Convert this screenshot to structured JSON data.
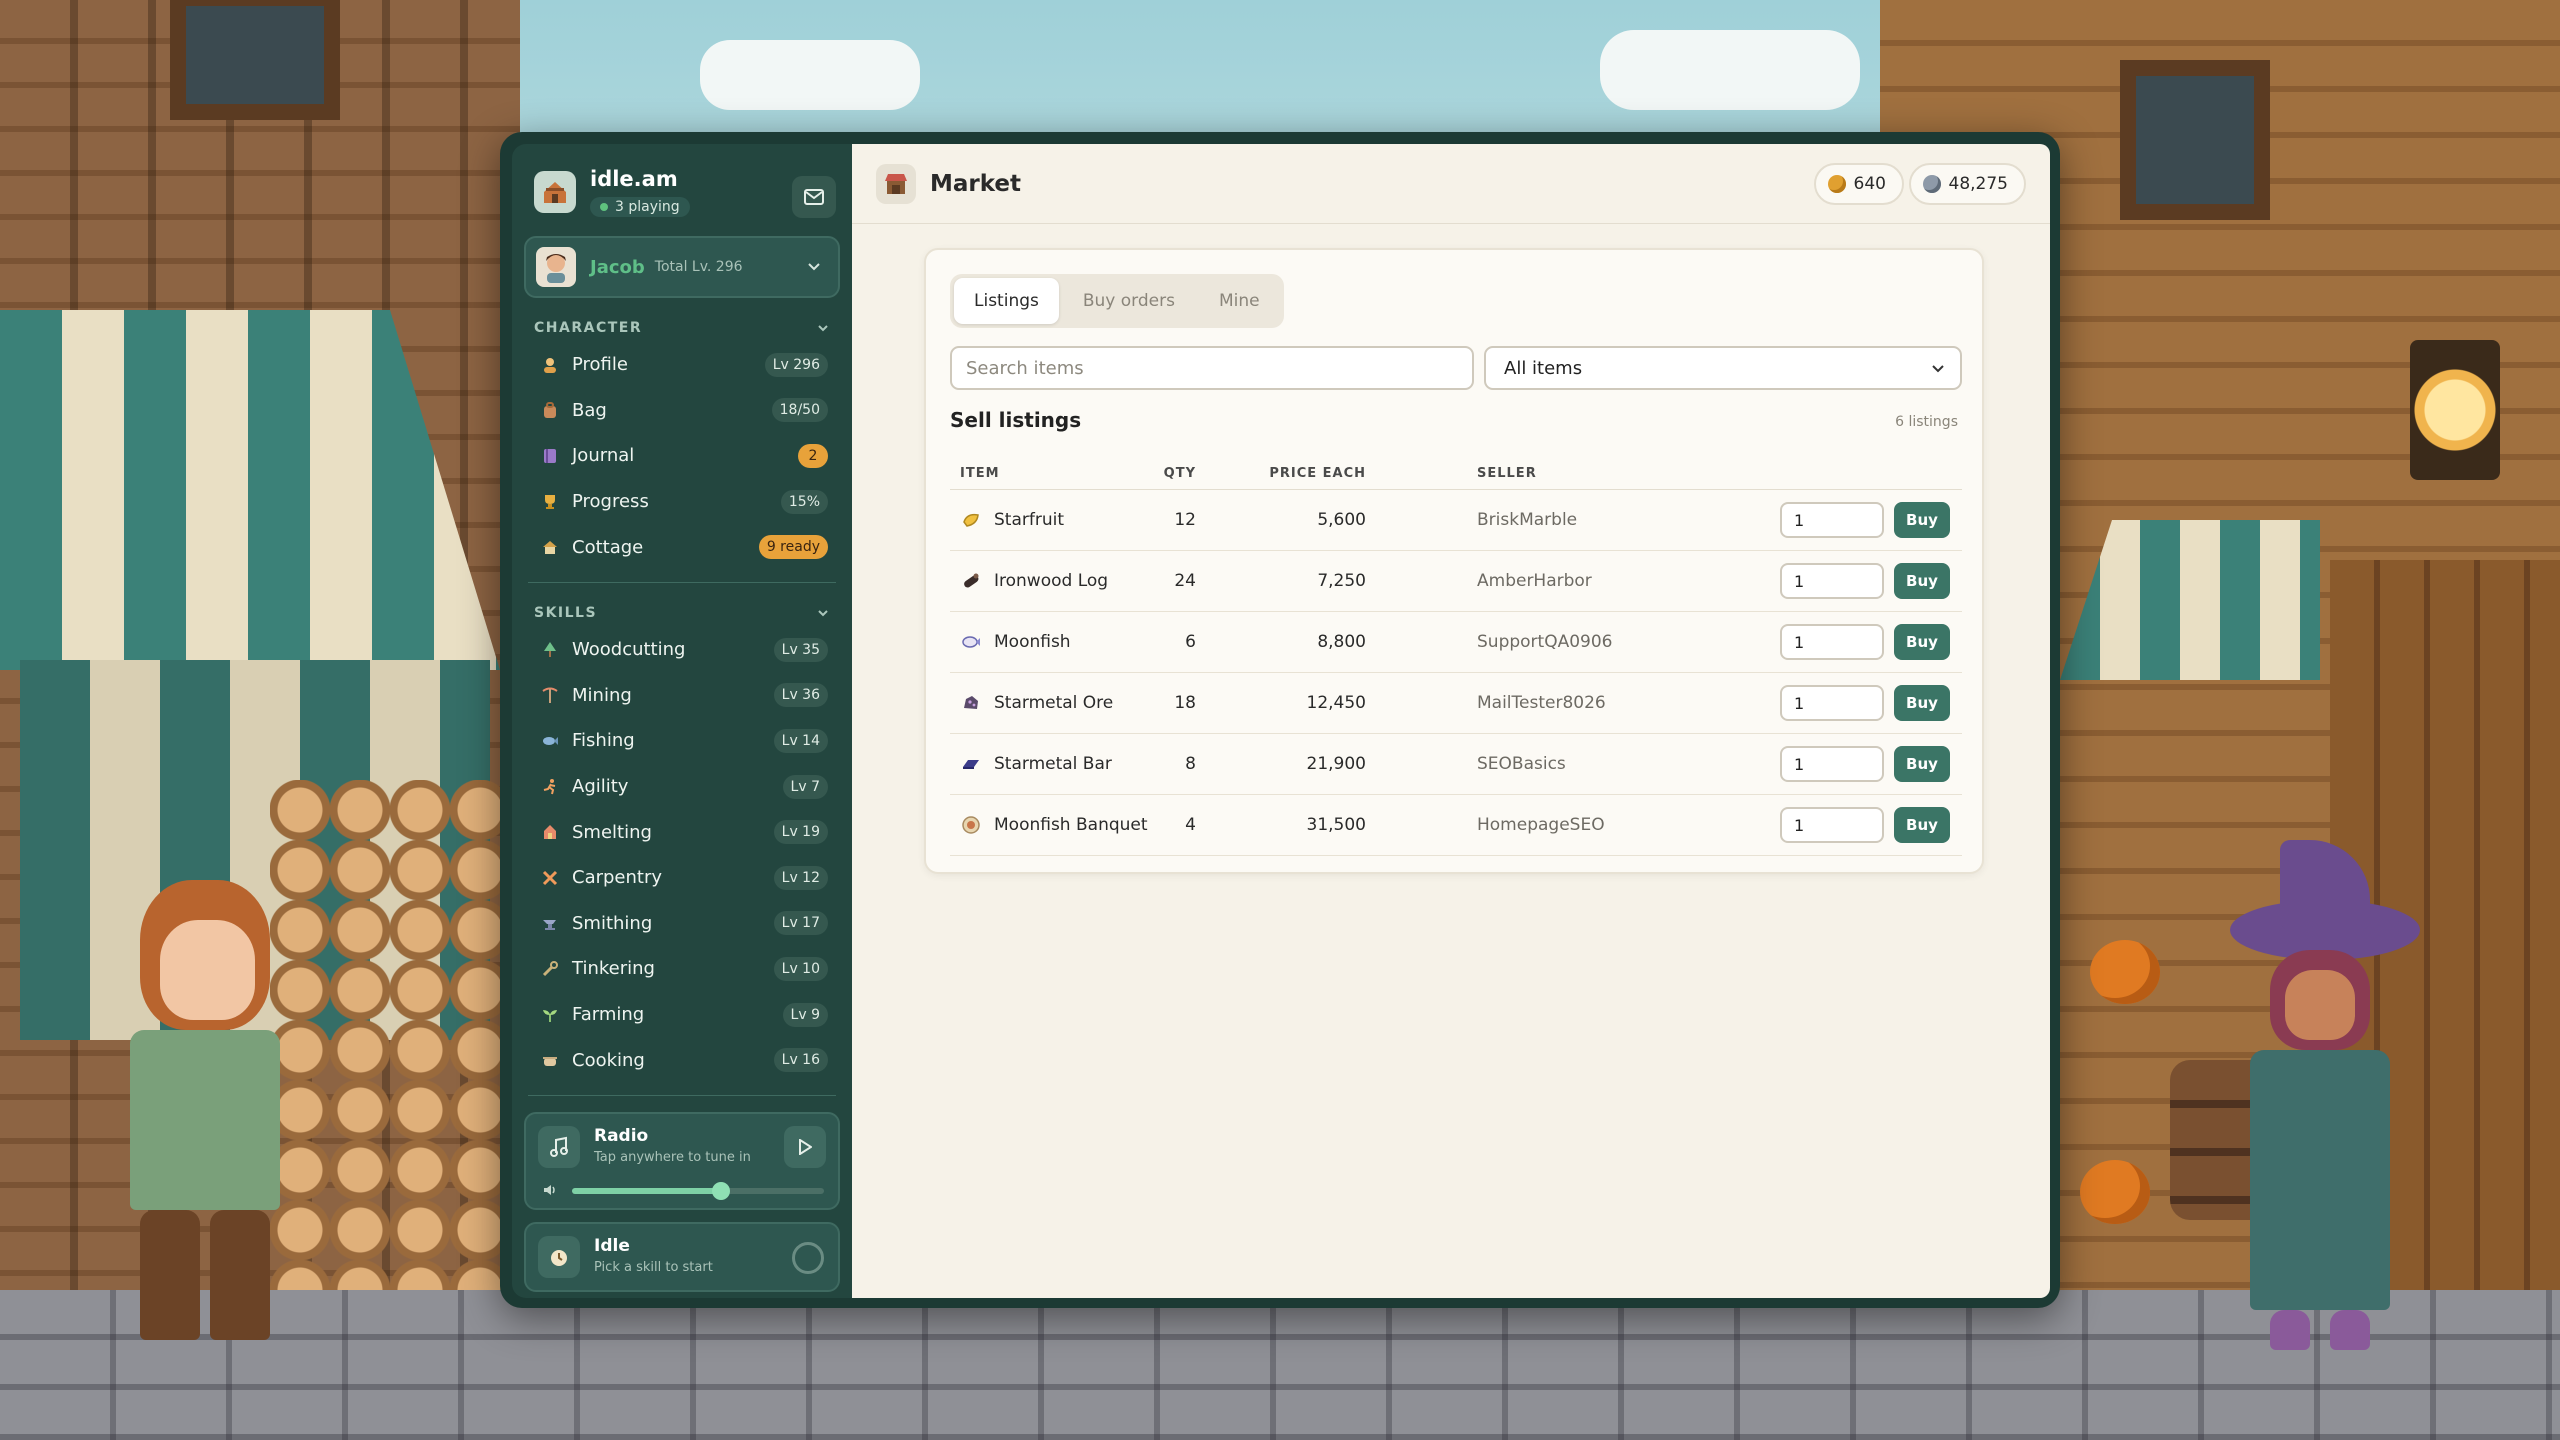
{
  "app": {
    "brand": "idle.am",
    "playing": "3 playing"
  },
  "character": {
    "name": "Jacob",
    "total_level": "Total Lv. 296"
  },
  "sections": {
    "character": "CHARACTER",
    "skills": "SKILLS"
  },
  "character_nav": [
    {
      "label": "Profile",
      "badge": "Lv 296",
      "icon": "person-icon"
    },
    {
      "label": "Bag",
      "badge": "18/50",
      "icon": "bag-icon"
    },
    {
      "label": "Journal",
      "badge": "2",
      "icon": "journal-icon"
    },
    {
      "label": "Progress",
      "badge": "15%",
      "icon": "trophy-icon"
    },
    {
      "label": "Cottage",
      "badge": "9 ready",
      "icon": "cottage-icon"
    }
  ],
  "skills_nav": [
    {
      "label": "Woodcutting",
      "badge": "Lv 35",
      "icon": "tree-icon"
    },
    {
      "label": "Mining",
      "badge": "Lv 36",
      "icon": "pickaxe-icon"
    },
    {
      "label": "Fishing",
      "badge": "Lv 14",
      "icon": "fish-icon"
    },
    {
      "label": "Agility",
      "badge": "Lv 7",
      "icon": "runner-icon"
    },
    {
      "label": "Smelting",
      "badge": "Lv 19",
      "icon": "furnace-icon"
    },
    {
      "label": "Carpentry",
      "badge": "Lv 12",
      "icon": "saw-icon"
    },
    {
      "label": "Smithing",
      "badge": "Lv 17",
      "icon": "anvil-icon"
    },
    {
      "label": "Tinkering",
      "badge": "Lv 10",
      "icon": "wrench-icon"
    },
    {
      "label": "Farming",
      "badge": "Lv 9",
      "icon": "sprout-icon"
    },
    {
      "label": "Cooking",
      "badge": "Lv 16",
      "icon": "pot-icon"
    }
  ],
  "radio": {
    "title": "Radio",
    "subtitle": "Tap anywhere to tune in",
    "volume": 0.59
  },
  "idle": {
    "title": "Idle",
    "subtitle": "Pick a skill to start"
  },
  "header": {
    "title": "Market",
    "gold": "640",
    "silver": "48,275"
  },
  "market": {
    "tabs": [
      "Listings",
      "Buy orders",
      "Mine"
    ],
    "active_tab": "Listings",
    "search_placeholder": "Search items",
    "filter": "All items",
    "list_title": "Sell listings",
    "list_count": "6 listings",
    "columns": {
      "item": "ITEM",
      "qty": "QTY",
      "price": "PRICE EACH",
      "seller": "SELLER"
    },
    "buy_label": "Buy",
    "listings": [
      {
        "item": "Starfruit",
        "qty": "12",
        "price": "5,600",
        "seller": "BriskMarble",
        "amount": "1",
        "icon": "starfruit-icon"
      },
      {
        "item": "Ironwood Log",
        "qty": "24",
        "price": "7,250",
        "seller": "AmberHarbor",
        "amount": "1",
        "icon": "log-icon"
      },
      {
        "item": "Moonfish",
        "qty": "6",
        "price": "8,800",
        "seller": "SupportQA0906",
        "amount": "1",
        "icon": "fish-icon"
      },
      {
        "item": "Starmetal Ore",
        "qty": "18",
        "price": "12,450",
        "seller": "MailTester8026",
        "amount": "1",
        "icon": "ore-icon"
      },
      {
        "item": "Starmetal Bar",
        "qty": "8",
        "price": "21,900",
        "seller": "SEOBasics",
        "amount": "1",
        "icon": "bar-icon"
      },
      {
        "item": "Moonfish Banquet",
        "qty": "4",
        "price": "31,500",
        "seller": "HomepageSEO",
        "amount": "1",
        "icon": "banquet-icon"
      }
    ]
  },
  "colors": {
    "accent": "#3b7566",
    "sidebar": "#23463f",
    "badge_orange": "#e8a23a",
    "gold": "#e0a030",
    "silver": "#8e9aa8"
  }
}
